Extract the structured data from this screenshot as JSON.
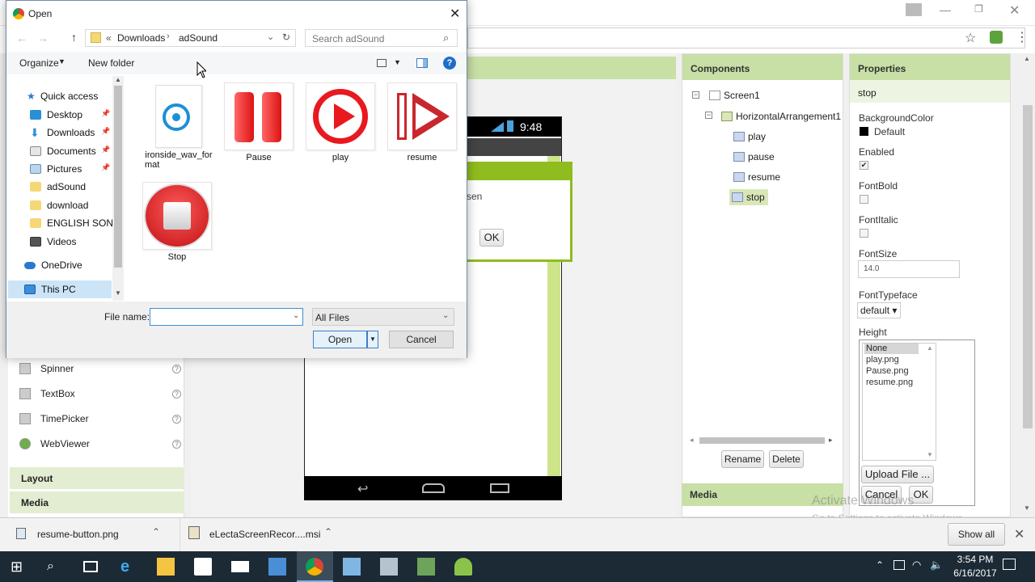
{
  "dialog": {
    "title": "Open",
    "breadcrumb": {
      "prefix": "«",
      "parts": [
        "Downloads",
        "adSound"
      ]
    },
    "search_placeholder": "Search adSound",
    "organize": "Organize",
    "new_folder": "New folder",
    "sidebar": [
      {
        "label": "Quick access",
        "icon": "star-icon"
      },
      {
        "label": "Desktop",
        "icon": "desktop-icon"
      },
      {
        "label": "Downloads",
        "icon": "download-arrow-icon"
      },
      {
        "label": "Documents",
        "icon": "documents-icon"
      },
      {
        "label": "Pictures",
        "icon": "pictures-icon"
      },
      {
        "label": "adSound",
        "icon": "folder-icon"
      },
      {
        "label": "download",
        "icon": "folder-icon"
      },
      {
        "label": "ENGLISH SONG",
        "icon": "folder-icon"
      },
      {
        "label": "Videos",
        "icon": "videos-icon"
      },
      {
        "label": "OneDrive",
        "icon": "cloud-icon"
      },
      {
        "label": "This PC",
        "icon": "computer-icon"
      }
    ],
    "files": [
      {
        "name": "ironside_wav_format",
        "line1": "ironside_wav_for",
        "line2": "mat",
        "icon": "audio-file-icon"
      },
      {
        "name": "Pause",
        "icon": "pause-icon"
      },
      {
        "name": "play",
        "icon": "play-icon"
      },
      {
        "name": "resume",
        "icon": "resume-icon"
      },
      {
        "name": "Stop",
        "icon": "stop-icon"
      }
    ],
    "file_name_label": "File name:",
    "file_name_value": "",
    "filter": "All Files",
    "open": "Open",
    "cancel": "Cancel"
  },
  "palette": {
    "items": [
      {
        "label": "Spinner"
      },
      {
        "label": "TextBox"
      },
      {
        "label": "TimePicker"
      },
      {
        "label": "WebViewer"
      }
    ],
    "help": "?",
    "categories": [
      "Layout",
      "Media"
    ]
  },
  "phone": {
    "time": "9:48",
    "dialog_text": "sen",
    "ok": "OK"
  },
  "components": {
    "title": "Components",
    "tree": {
      "screen": "Screen1",
      "arrangement": "HorizontalArrangement1",
      "children": [
        "play",
        "pause",
        "resume",
        "stop"
      ]
    },
    "rename": "Rename",
    "delete": "Delete",
    "media_title": "Media"
  },
  "properties": {
    "title": "Properties",
    "selected": "stop",
    "bg_label": "BackgroundColor",
    "bg_value": "Default",
    "enabled_label": "Enabled",
    "enabled_check": "✔",
    "fontbold_label": "FontBold",
    "fontitalic_label": "FontItalic",
    "fontsize_label": "FontSize",
    "fontsize_value": "14.0",
    "typeface_label": "FontTypeface",
    "typeface_value": "default ▾",
    "height_label": "Height",
    "height_options": [
      "None",
      "play.png",
      "Pause.png",
      "resume.png"
    ],
    "upload": "Upload File ...",
    "cancel": "Cancel",
    "ok": "OK"
  },
  "watermark": {
    "line1": "Activate Windows",
    "line2": "Go to Settings to activate Windows."
  },
  "downloads": [
    {
      "name": "resume-button.png"
    },
    {
      "name": "eLectaScreenRecor....msi"
    }
  ],
  "show_all": "Show all",
  "clock": {
    "time": "3:54 PM",
    "date": "6/16/2017"
  },
  "colors": {
    "accent_green": "#8fbc1e",
    "header_green": "#c8dfa6",
    "taskbar": "#1c2a35",
    "red": "#e8191f"
  }
}
